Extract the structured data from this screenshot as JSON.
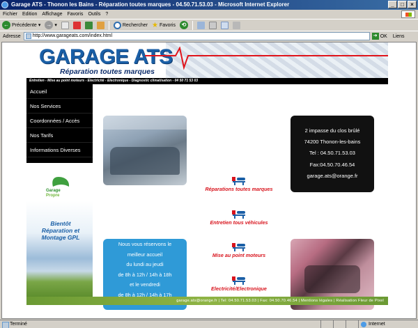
{
  "window": {
    "title": "Garage ATS - Thonon les Bains - Réparation toutes marques - 04.50.71.53.03 - Microsoft Internet Explorer"
  },
  "menu": [
    "Fichier",
    "Edition",
    "Affichage",
    "Favoris",
    "Outils",
    "?"
  ],
  "toolbar": {
    "back": "Précédente",
    "search": "Rechercher",
    "favorites": "Favoris"
  },
  "address": {
    "label": "Adresse",
    "url": "http://www.garageats.com/index.html",
    "go": "OK",
    "links": "Liens"
  },
  "site": {
    "logo": "GARAGE ATS",
    "slogan": "Réparation toutes marques",
    "strap": "Entretien - Mise au point moteurs - Electricité - Electronique - Diagnostic climatisation - 04 50 71 53 03",
    "nav": [
      "Accueil",
      "Nos Services",
      "Coordonnées / Accès",
      "Nos Tarifs",
      "Informations Diverses"
    ],
    "gp_logo": "Garage Propre",
    "gp_line1": "Garage",
    "gp_line2": "Propre",
    "bientot": [
      "Bientôt",
      "Réparation et",
      "Montage GPL"
    ],
    "services": [
      "Réparations toutes marques",
      "Entretien tous véhicules",
      "Mise au point moteurs",
      "Electricité/Electronique"
    ],
    "hours": [
      "Nous vous réservons le",
      "meilleur accueil",
      "du lundi au jeudi",
      "de 8h à 12h / 14h à 18h",
      "et le vendredi",
      "de 8h à 12h / 14h à 17h"
    ],
    "contact": [
      "2 impasse du clos brûlé",
      "74200 Thonon-les-bains",
      "Tel : 04.50.71.53.03",
      "Fax:04.50.70.46.54",
      "garage.ats@orange.fr"
    ],
    "footer": "garage.ats@orange.fr | Tel: 04.50.71.53.03 | Fax: 04.50.70.46.54 | Mentions légales | Réalisation Fleur de Pixel"
  },
  "status": {
    "left": "Terminé",
    "zone": "Internet"
  },
  "colors": {
    "brand_blue": "#1a5fa6",
    "service_red": "#d8141d",
    "hours_blue": "#2f9ad7",
    "footer_green": "#6b9a34"
  }
}
